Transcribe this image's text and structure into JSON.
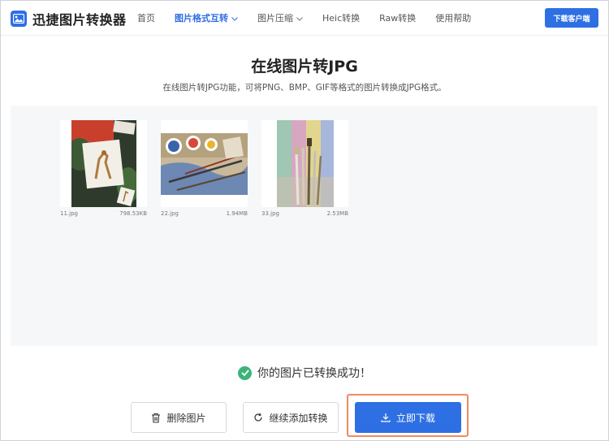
{
  "header": {
    "app_name": "迅捷图片转换器",
    "logo_icon": "image-icon",
    "nav": [
      {
        "label": "首页",
        "active": false,
        "dropdown": false
      },
      {
        "label": "图片格式互转",
        "active": true,
        "dropdown": true
      },
      {
        "label": "图片压缩",
        "active": false,
        "dropdown": true
      },
      {
        "label": "Heic转换",
        "active": false,
        "dropdown": false
      },
      {
        "label": "Raw转换",
        "active": false,
        "dropdown": false
      },
      {
        "label": "使用帮助",
        "active": false,
        "dropdown": false
      }
    ],
    "download_client_label": "下载客户端"
  },
  "hero": {
    "title": "在线图片转JPG",
    "subtitle": "在线图片转JPG功能，可将PNG、BMP、GIF等格式的图片转换成JPG格式。"
  },
  "files": [
    {
      "name": "11.jpg",
      "size": "798.53KB"
    },
    {
      "name": "22.jpg",
      "size": "1.94MB"
    },
    {
      "name": "33.jpg",
      "size": "2.53MB"
    }
  ],
  "status": {
    "message": "你的图片已转换成功！",
    "icon": "check-circle-icon"
  },
  "actions": {
    "delete_label": "删除图片",
    "continue_label": "继续添加转换",
    "download_label": "立即下载"
  },
  "colors": {
    "accent": "#2f6fe4",
    "success": "#3cb37a",
    "highlight": "#f08a5d"
  }
}
